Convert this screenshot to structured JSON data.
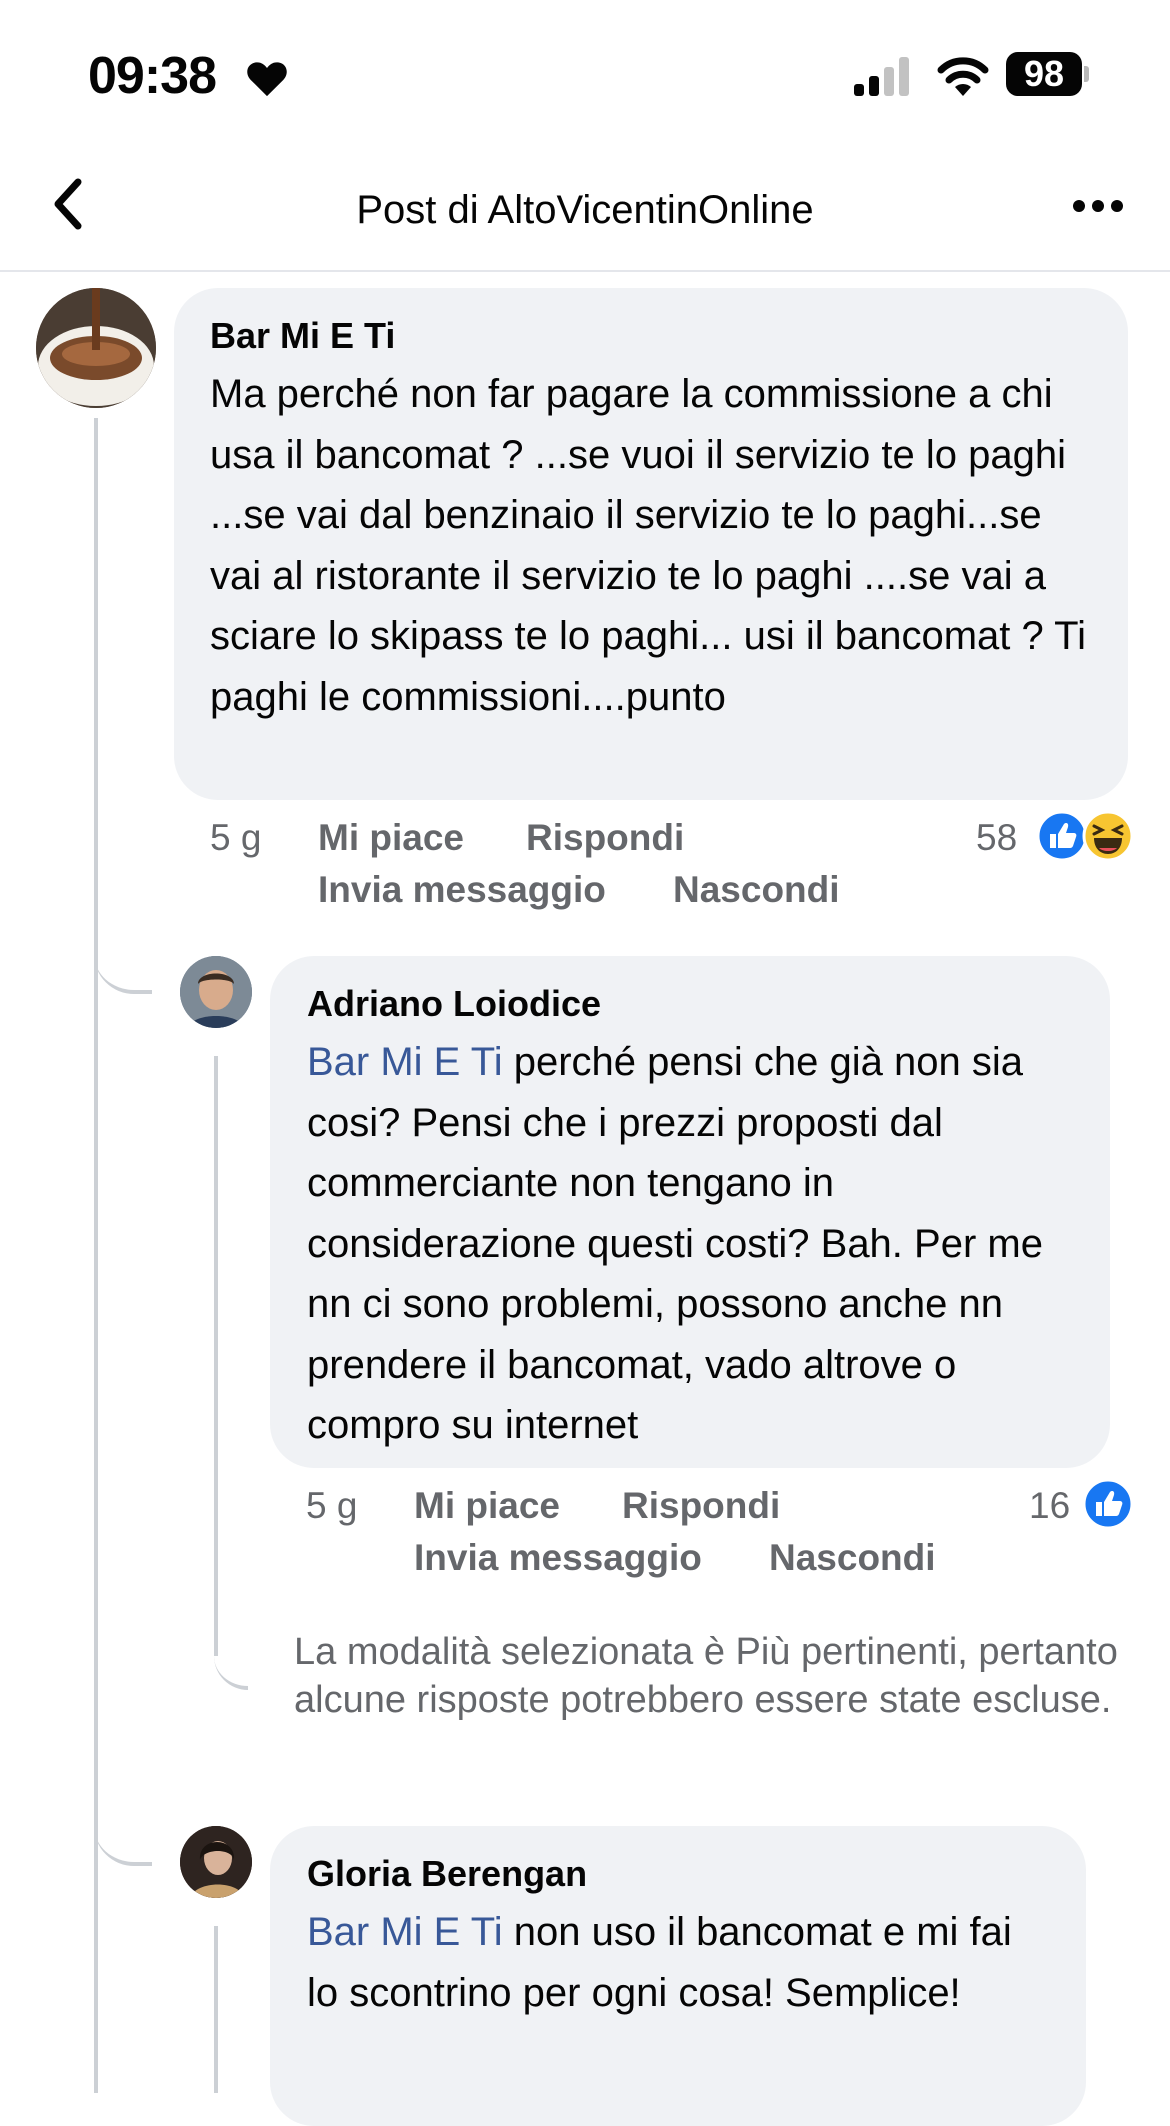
{
  "status_bar": {
    "time": "09:38",
    "battery": "98"
  },
  "header": {
    "title": "Post di AltoVicentinOnline"
  },
  "comments": [
    {
      "author": "Bar Mi E Ti",
      "text": "Ma perché non far pagare la commissione a chi usa il bancomat ? ...se vuoi il servizio te lo paghi ...se vai dal benzinaio il servizio te lo paghi...se vai al ristorante il servizio te lo paghi ....se vai a sciare lo skipass te lo paghi... usi il bancomat ? Ti paghi le commissioni....punto",
      "time": "5 g",
      "like": "Mi piace",
      "reply": "Rispondi",
      "message": "Invia messaggio",
      "hide": "Nascondi",
      "reaction_count": "58",
      "reactions": [
        "like-reaction-icon",
        "haha-reaction-icon"
      ]
    },
    {
      "author": "Adriano Loiodice",
      "mention": "Bar Mi E Ti",
      "text": "perché pensi che già non sia cosi? Pensi che i prezzi proposti dal commerciante non tengano in considerazione questi costi? Bah. Per me nn ci sono problemi, possono anche nn prendere il bancomat, vado altrove o compro su internet",
      "time": "5 g",
      "like": "Mi piace",
      "reply": "Rispondi",
      "message": "Invia messaggio",
      "hide": "Nascondi",
      "reaction_count": "16",
      "reactions": [
        "like-reaction-icon"
      ]
    },
    {
      "author": "Gloria Berengan",
      "mention": "Bar Mi E Ti",
      "text": "non uso il bancomat e mi fai lo scontrino per ogni cosa! Semplice!"
    }
  ],
  "filter_note": "La modalità selezionata è Più pertinenti, pertanto alcune risposte potrebbero essere state escluse.",
  "colors": {
    "link": "#385898",
    "bubble": "#f0f2f5",
    "meta": "#65676b",
    "like_blue": "#1877f2"
  }
}
